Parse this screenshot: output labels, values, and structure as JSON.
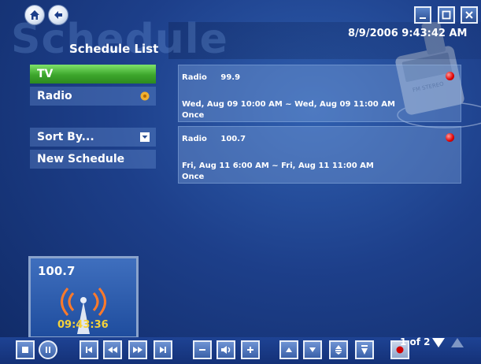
{
  "header": {
    "watermark": "Schedule",
    "title": "Schedule List",
    "datetime": "8/9/2006 9:43:42 AM",
    "photo_label": "FM STEREO"
  },
  "nav": {
    "home_icon": "home-icon",
    "back_icon": "back-arrow-icon"
  },
  "window_controls": {
    "minimize_icon": "minimize-icon",
    "maximize_icon": "maximize-icon",
    "close_icon": "close-icon"
  },
  "sidebar": {
    "items": [
      {
        "label": "TV",
        "active": true
      },
      {
        "label": "Radio",
        "active": false,
        "icon": "radio-wave-icon"
      }
    ],
    "actions": [
      {
        "label": "Sort By...",
        "icon": "chevron-down-icon"
      },
      {
        "label": "New Schedule"
      }
    ]
  },
  "schedules": [
    {
      "type": "Radio",
      "channel": "99.9",
      "time_range": "Wed, Aug 09 10:00 AM ~ Wed, Aug 09 11:00 AM",
      "repeat": "Once"
    },
    {
      "type": "Radio",
      "channel": "100.7",
      "time_range": "Fri, Aug 11 6:00 AM ~ Fri, Aug 11 11:00 AM",
      "repeat": "Once"
    }
  ],
  "now_playing": {
    "frequency": "100.7",
    "time": "09:43:36"
  },
  "pagination": {
    "text": "1 of 2"
  },
  "controls": [
    "stop-icon",
    "pause-icon",
    "skip-back-icon",
    "rewind-icon",
    "fast-forward-icon",
    "skip-forward-icon",
    "volume-down-icon",
    "mute-icon",
    "volume-up-icon",
    "channel-up-icon",
    "channel-down-icon",
    "page-up-icon",
    "page-down-icon",
    "record-icon"
  ],
  "colors": {
    "background": "#1d3f8a",
    "active_green": "#3da62c",
    "record_red": "#e00000",
    "time_yellow": "#f5d23a"
  }
}
